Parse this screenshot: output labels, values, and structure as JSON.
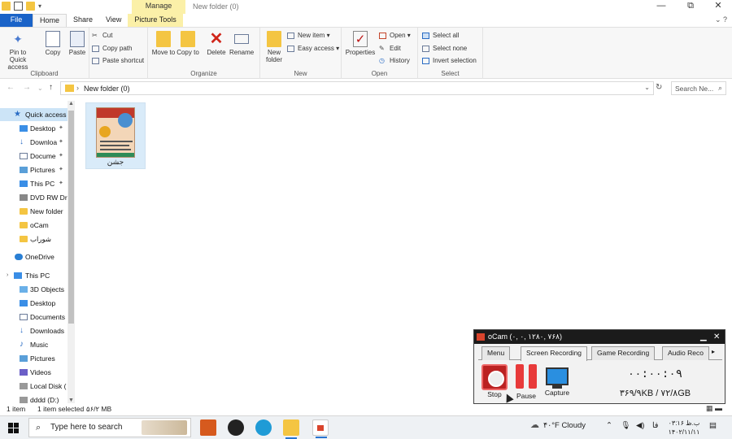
{
  "window": {
    "title": "New folder (0)",
    "manage_tab": "Manage",
    "controls": {
      "minimize": "—",
      "restore": "⧉",
      "close": "✕"
    }
  },
  "ribbon_tabs": [
    "File",
    "Home",
    "Share",
    "View",
    "Picture Tools"
  ],
  "ribbon": {
    "clipboard": {
      "label": "Clipboard",
      "pin": "Pin to Quick access",
      "copy": "Copy",
      "paste": "Paste",
      "cut": "Cut",
      "copy_path": "Copy path",
      "paste_shortcut": "Paste shortcut"
    },
    "organize": {
      "label": "Organize",
      "move_to": "Move to",
      "copy_to": "Copy to",
      "delete": "Delete",
      "rename": "Rename"
    },
    "new": {
      "label": "New",
      "new_folder": "New folder",
      "new_item": "New item",
      "easy_access": "Easy access"
    },
    "open": {
      "label": "Open",
      "properties": "Properties",
      "open": "Open",
      "edit": "Edit",
      "history": "History"
    },
    "select": {
      "label": "Select",
      "select_all": "Select all",
      "select_none": "Select none",
      "invert": "Invert selection"
    }
  },
  "address": {
    "path": "New folder (0)",
    "search_placeholder": "Search Ne..."
  },
  "nav": {
    "quick_access": "Quick access",
    "qa_items": [
      "Desktop",
      "Downloa",
      "Docume",
      "Pictures",
      "This PC",
      "DVD RW Dr",
      "New folder",
      "oCam",
      "شوراب"
    ],
    "onedrive": "OneDrive",
    "this_pc": "This PC",
    "pc_items": [
      "3D Objects",
      "Desktop",
      "Documents",
      "Downloads",
      "Music",
      "Pictures",
      "Videos",
      "Local Disk (",
      "dddd (D:)"
    ]
  },
  "files": [
    {
      "name": "جشن"
    }
  ],
  "status": {
    "count": "1 item",
    "selected": "1 item selected",
    "size": "۵۶/۲ MB"
  },
  "ocam": {
    "title": "oCam (۰, ۰, ۱۲۸۰, ۷۶۸)",
    "tabs": [
      "Menu",
      "Screen Recording",
      "Game Recording",
      "Audio Reco"
    ],
    "stop": "Stop",
    "pause": "Pause",
    "capture": "Capture",
    "timer": "۰۰:۰۰:۰۹",
    "size": "۳۶۹/۹KB / ۷۲/۸GB"
  },
  "taskbar": {
    "search_placeholder": "Type here to search",
    "weather": "۴۰°F Cloudy",
    "lang": "فا",
    "time": "۰۳:۱۶ ب.ظ",
    "date": "۱۴۰۲/۱۱/۱۱"
  },
  "colors": {
    "file_tab": "#1a63c8",
    "picture_tools": "#fbf0a8",
    "selection": "#cce4f7",
    "ocam_title": "#1b1b1b",
    "stop_red": "#bb2222"
  }
}
